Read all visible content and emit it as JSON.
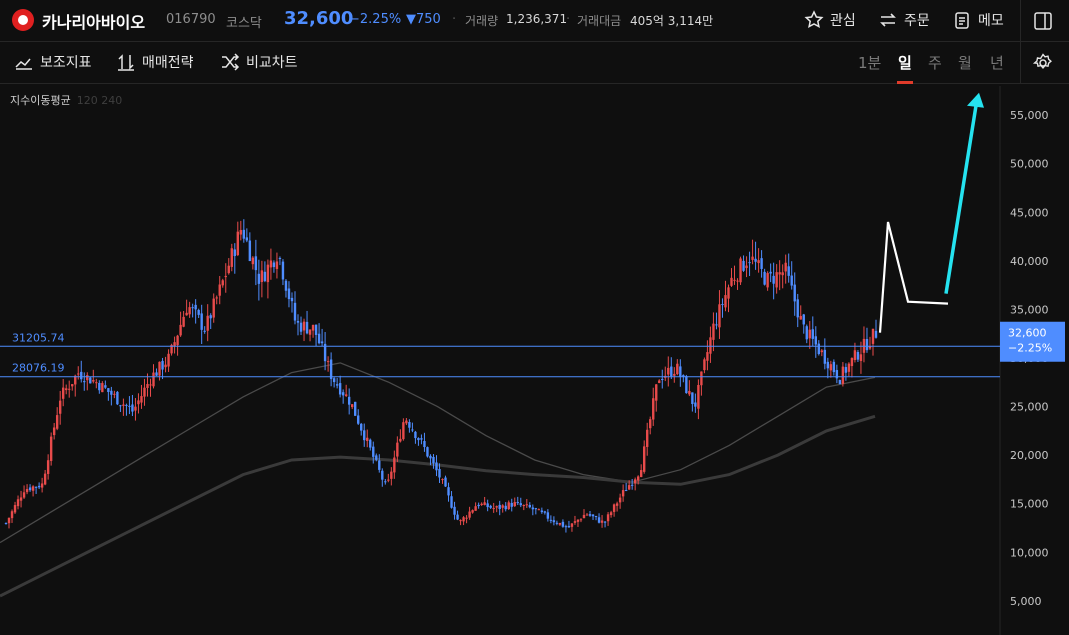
{
  "header": {
    "stock_name": "카나리아바이오",
    "stock_code": "016790",
    "market": "코스닥",
    "price": "32,600",
    "change_pct": "−2.25%",
    "change_abs": "▼750",
    "separator": "·",
    "volume_label": "거래량",
    "volume_value": "1,236,371",
    "amount_label": "거래대금",
    "amount_value": "405억 3,114만",
    "buttons": {
      "watch": "관심",
      "order": "주문",
      "memo": "메모"
    }
  },
  "toolbar": {
    "indicators": "보조지표",
    "strategy": "매매전략",
    "compare": "비교차트",
    "periods": [
      "1분",
      "일",
      "주",
      "월",
      "년"
    ],
    "active_period": "일"
  },
  "legend": {
    "label": "지수이동평균",
    "values": "120 240"
  },
  "colors": {
    "up": "#e84b4b",
    "down": "#4f8dff",
    "accent": "#4f8dff",
    "annotation_arrow": "#25e3f0",
    "annotation_line": "#ffffff"
  },
  "chart_data": {
    "type": "candlestick",
    "ylim": [
      2000,
      58000
    ],
    "y_ticks": [
      5000,
      10000,
      15000,
      20000,
      25000,
      30000,
      35000,
      40000,
      45000,
      50000,
      55000
    ],
    "y_tick_labels": [
      "5,000",
      "10,000",
      "15,000",
      "20,000",
      "25,000",
      "30,000",
      "35,000",
      "40,000",
      "45,000",
      "50,000",
      "55,000"
    ],
    "price_levels": [
      {
        "label": "31205.74",
        "value": 31205.74
      },
      {
        "label": "28076.19",
        "value": 28076.19
      }
    ],
    "current_price": {
      "value": 32600,
      "label": "32,600",
      "change": "−2.25%"
    },
    "ema": [
      {
        "period": 120,
        "values": [
          11000,
          14000,
          17000,
          20000,
          23000,
          26000,
          28500,
          29500,
          27500,
          25000,
          22000,
          19500,
          18000,
          17200,
          18500,
          21000,
          24000,
          27000,
          28000
        ]
      },
      {
        "period": 240,
        "values": [
          5500,
          8000,
          10500,
          13000,
          15500,
          18000,
          19500,
          19800,
          19500,
          19000,
          18400,
          18000,
          17700,
          17200,
          17000,
          18000,
          20000,
          22500,
          24000
        ]
      }
    ],
    "price_path": [
      13000,
      16500,
      17000,
      26000,
      28500,
      27500,
      26000,
      24500,
      28000,
      30000,
      35500,
      33000,
      38000,
      43500,
      38000,
      41000,
      33500,
      33000,
      28000,
      25500,
      21000,
      16500,
      24000,
      21000,
      17500,
      13000,
      15000,
      14500,
      15000,
      14500,
      13500,
      12500,
      14000,
      13000,
      16000,
      18500,
      28000,
      29000,
      25000,
      33000,
      38000,
      40500,
      38000,
      39000,
      33000,
      30500,
      28000,
      30500,
      32600
    ],
    "projection": [
      32600,
      44000,
      35800,
      35600,
      57000
    ]
  }
}
